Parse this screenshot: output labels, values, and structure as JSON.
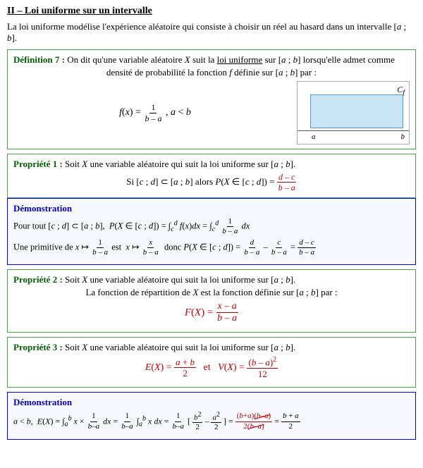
{
  "section": {
    "title": "II – Loi uniforme sur un intervalle",
    "intro": "La loi uniforme modélise l'expérience aléatoire qui consiste à choisir un réel au hasard dans un intervalle [a ; b]."
  },
  "definition": {
    "label": "Définition 7 :",
    "text": "On dit qu'une variable aléatoire X suit la ",
    "highlight": "loi uniforme",
    "text2": " sur [a ; b] lorsqu'elle admet comme",
    "text3": "densité de probabilité la fonction f définie sur [a ; b] par :"
  },
  "propriete1": {
    "label": "Propriété 1 :",
    "text": "Soit X une variable aléatoire qui suit la loi uniforme sur [a ; b].",
    "text2": "Si [c ; d] ⊂ [a ; b] alors P(X ∈ [c ; d]) =",
    "fraction": {
      "num": "d – c",
      "den": "b – a"
    }
  },
  "demo1": {
    "label": "Démonstration",
    "line1": "Pour tout [c ; d] ⊂ [a ; b], P(X ∈ [c ; d]) = ∫f(x)dx = ∫(1/(b-a))dx",
    "line2": "Une primitive de x ↦ 1/(b-a) est x ↦ x/(b-a) donc P(X ∈ [c ; d]) = d/(b-a) – c/(b-a) = (d-c)/(b-a)"
  },
  "propriete2": {
    "label": "Propriété 2 :",
    "text": "Soit X une variable aléatoire qui suit la loi uniforme sur [a ; b].",
    "text2": "La fonction de répartition de X est la fonction définie sur [a ; b] par :",
    "formula": "F(X) = (x – a) / (b – a)"
  },
  "propriete3": {
    "label": "Propriété 3 :",
    "text": "Soit X une variable aléatoire qui suit la loi uniforme sur [a ; b].",
    "formula_E": "E(X) = (a + b) / 2",
    "formula_V": "V(X) = (b – a)² / 12"
  },
  "demo2": {
    "label": "Démonstration",
    "line1": "a < b, E(X) = ∫x × (1/(b-a))dx = (1/(b-a))∫x dx = (1/(b-a))[x²/2 – a²/2] = ((b+a)(b-a)) / (2(b-a)) = (b+a)/2"
  }
}
